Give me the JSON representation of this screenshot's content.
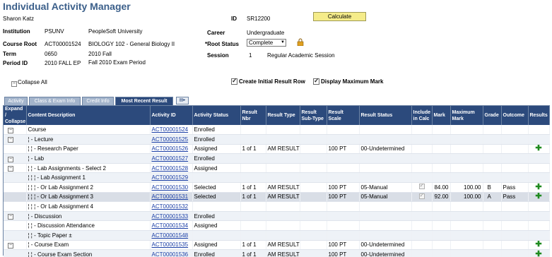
{
  "title": "Individual Activity Manager",
  "student": {
    "name": "Sharon Katz",
    "id_label": "ID",
    "id": "SR12200"
  },
  "calculate_label": "Calculate",
  "fields": {
    "institution_label": "Institution",
    "institution_code": "PSUNV",
    "institution_name": "PeopleSoft University",
    "career_label": "Career",
    "career_value": "Undergraduate",
    "course_root_label": "Course Root",
    "course_root_code": "ACT00001524",
    "course_root_name": "BIOLOGY  102 - General Biology II",
    "root_status_label": "*Root Status",
    "root_status_value": "Complete",
    "term_label": "Term",
    "term_code": "0650",
    "term_name": "2010 Fall",
    "session_label": "Session",
    "session_code": "1",
    "session_name": "Regular Academic Session",
    "period_label": "Period ID",
    "period_code": "2010 FALL EP",
    "period_name": "Fall 2010 Exam Period"
  },
  "collapse_all": "Collapse All",
  "create_initial": "Create Initial Result Row",
  "display_max": "Display Maximum Mark",
  "tabs": [
    "Activity",
    "Class & Exam Info",
    "Credit Info",
    "Most Recent Result"
  ],
  "columns": [
    "Expand / Collapse",
    "Content Description",
    "Activity ID",
    "Activity Status",
    "Result Nbr",
    "Result Type",
    "Result Sub-Type",
    "Result Scale",
    "Result Status",
    "Include in Calc",
    "Mark",
    "Maximum Mark",
    "Grade",
    "Outcome",
    "Results"
  ],
  "rows": [
    {
      "exp": "⊟",
      "desc": "Course",
      "act": "ACT00001524",
      "status": "Enrolled",
      "nbr": "",
      "type": "",
      "scale": "",
      "rstatus": "",
      "calc": false,
      "mark": "",
      "max": "",
      "grade": "",
      "outcome": "",
      "plus": false
    },
    {
      "exp": "⊟",
      "desc": "¦ - Lecture",
      "act": "ACT00001525",
      "status": "Enrolled",
      "nbr": "",
      "type": "",
      "scale": "",
      "rstatus": "",
      "calc": false,
      "mark": "",
      "max": "",
      "grade": "",
      "outcome": "",
      "plus": false
    },
    {
      "exp": "",
      "desc": "¦   ¦ - Research Paper",
      "act": "ACT00001526",
      "status": "Assigned",
      "nbr": "1 of 1",
      "type": "AM RESULT",
      "scale": "100 PT",
      "rstatus": "00-Undetermined",
      "calc": false,
      "mark": "",
      "max": "",
      "grade": "",
      "outcome": "",
      "plus": true
    },
    {
      "exp": "⊟",
      "desc": "¦ - Lab",
      "act": "ACT00001527",
      "status": "Enrolled",
      "nbr": "",
      "type": "",
      "scale": "",
      "rstatus": "",
      "calc": false,
      "mark": "",
      "max": "",
      "grade": "",
      "outcome": "",
      "plus": false
    },
    {
      "exp": "⊟",
      "desc": "¦   ¦ - Lab Assignments - Select 2",
      "act": "ACT00001528",
      "status": "Assigned",
      "nbr": "",
      "type": "",
      "scale": "",
      "rstatus": "",
      "calc": false,
      "mark": "",
      "max": "",
      "grade": "",
      "outcome": "",
      "plus": false
    },
    {
      "exp": "",
      "desc": "¦   ¦   ¦ - Lab Assignment 1",
      "act": "ACT00001529",
      "status": "",
      "nbr": "",
      "type": "",
      "scale": "",
      "rstatus": "",
      "calc": false,
      "mark": "",
      "max": "",
      "grade": "",
      "outcome": "",
      "plus": false
    },
    {
      "exp": "",
      "desc": "¦   ¦   ¦ - Or Lab Assignment 2",
      "act": "ACT00001530",
      "status": "Selected",
      "nbr": "1 of 1",
      "type": "AM RESULT",
      "scale": "100 PT",
      "rstatus": "05-Manual",
      "calc": true,
      "mark": "84.00",
      "max": "100.00",
      "grade": "B",
      "outcome": "Pass",
      "plus": true
    },
    {
      "exp": "",
      "desc": "¦   ¦   ¦ - Or Lab Assignment 3",
      "act": "ACT00001531",
      "status": "Selected",
      "nbr": "1 of 1",
      "type": "AM RESULT",
      "scale": "100 PT",
      "rstatus": "05-Manual",
      "calc": true,
      "mark": "92.00",
      "max": "100.00",
      "grade": "A",
      "outcome": "Pass",
      "plus": true
    },
    {
      "exp": "",
      "desc": "¦   ¦   ¦ - Or Lab Assignment 4",
      "act": "ACT00001532",
      "status": "",
      "nbr": "",
      "type": "",
      "scale": "",
      "rstatus": "",
      "calc": false,
      "mark": "",
      "max": "",
      "grade": "",
      "outcome": "",
      "plus": false
    },
    {
      "exp": "⊟",
      "desc": "¦ - Discussion",
      "act": "ACT00001533",
      "status": "Enrolled",
      "nbr": "",
      "type": "",
      "scale": "",
      "rstatus": "",
      "calc": false,
      "mark": "",
      "max": "",
      "grade": "",
      "outcome": "",
      "plus": false
    },
    {
      "exp": "",
      "desc": "¦   ¦ - Discussion Attendance",
      "act": "ACT00001534",
      "status": "Assigned",
      "nbr": "",
      "type": "",
      "scale": "",
      "rstatus": "",
      "calc": false,
      "mark": "",
      "max": "",
      "grade": "",
      "outcome": "",
      "plus": false
    },
    {
      "exp": "",
      "desc": "¦   ¦ - Topic Paper  ±",
      "act": "ACT00001548",
      "status": "",
      "nbr": "",
      "type": "",
      "scale": "",
      "rstatus": "",
      "calc": false,
      "mark": "",
      "max": "",
      "grade": "",
      "outcome": "",
      "plus": false
    },
    {
      "exp": "⊟",
      "desc": "¦ - Course Exam",
      "act": "ACT00001535",
      "status": "Assigned",
      "nbr": "1 of 1",
      "type": "AM RESULT",
      "scale": "100 PT",
      "rstatus": "00-Undetermined",
      "calc": false,
      "mark": "",
      "max": "",
      "grade": "",
      "outcome": "",
      "plus": true
    },
    {
      "exp": "",
      "desc": "¦   ¦ - Course Exam Section",
      "act": "ACT00001536",
      "status": "Enrolled",
      "nbr": "1 of 1",
      "type": "AM RESULT",
      "scale": "100 PT",
      "rstatus": "00-Undetermined",
      "calc": false,
      "mark": "",
      "max": "",
      "grade": "",
      "outcome": "",
      "plus": true
    }
  ]
}
